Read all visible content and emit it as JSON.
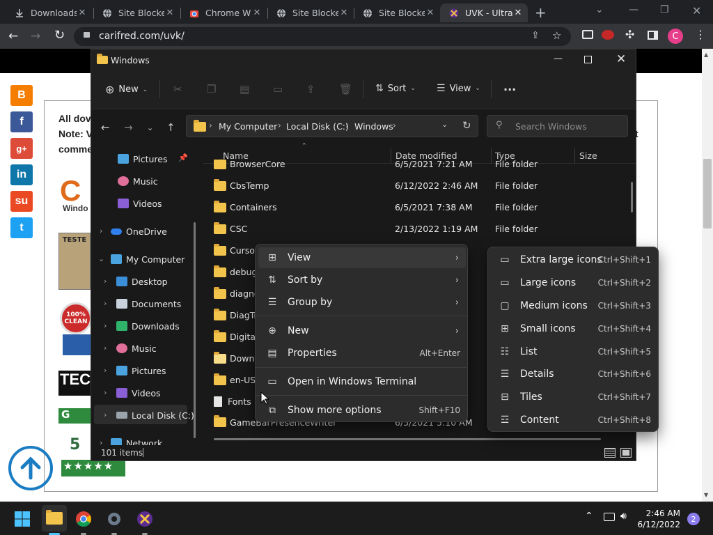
{
  "browser": {
    "tabs": [
      {
        "title": "Downloads",
        "icon": "download-icon"
      },
      {
        "title": "Site Blocke",
        "icon": "globe-icon"
      },
      {
        "title": "Chrome W",
        "icon": "chrome-web-store-icon"
      },
      {
        "title": "Site Blocke",
        "icon": "globe-icon"
      },
      {
        "title": "Site Blocke",
        "icon": "globe-icon"
      },
      {
        "title": "UVK - Ultra",
        "icon": "uvk-icon"
      }
    ],
    "new_tab": "+",
    "url": "carifred.com/uvk/",
    "profile_initial": "C"
  },
  "webpage": {
    "text_line1": "All dov",
    "text_line2": "Note: V",
    "text_line3": "comme",
    "right_char1": "t",
    "badge_tester": "TESTE",
    "badge_clean": "100% CLEAN",
    "badge_teo": "TEC",
    "badge_g": "G",
    "rating_num": "5",
    "logo_text": "Windo",
    "social": [
      "blogger",
      "facebook",
      "google-plus",
      "linkedin",
      "stumbleupon",
      "twitter"
    ]
  },
  "explorer": {
    "title": "Windows",
    "toolbar": {
      "new_label": "New",
      "sort_label": "Sort",
      "view_label": "View",
      "more": "..."
    },
    "breadcrumb": [
      "My Computer",
      "Local Disk (C:)",
      "Windows"
    ],
    "search_placeholder": "Search Windows",
    "nav": [
      {
        "label": "Pictures",
        "pinned": true
      },
      {
        "label": "Music"
      },
      {
        "label": "Videos"
      },
      {
        "label": "OneDrive"
      },
      {
        "label": "My Computer"
      },
      {
        "label": "Desktop"
      },
      {
        "label": "Documents"
      },
      {
        "label": "Downloads"
      },
      {
        "label": "Music"
      },
      {
        "label": "Pictures"
      },
      {
        "label": "Videos"
      },
      {
        "label": "Local Disk (C:)"
      },
      {
        "label": "Network"
      }
    ],
    "columns": [
      "Name",
      "Date modified",
      "Type",
      "Size"
    ],
    "files": [
      {
        "name": "BrowserCore",
        "date": "6/5/2021 7:21 AM",
        "type": "File folder"
      },
      {
        "name": "CbsTemp",
        "date": "6/12/2022 2:46 AM",
        "type": "File folder"
      },
      {
        "name": "Containers",
        "date": "6/5/2021 7:38 AM",
        "type": "File folder"
      },
      {
        "name": "CSC",
        "date": "2/13/2022 1:19 AM",
        "type": "File folder"
      },
      {
        "name": "Cursor",
        "date": "",
        "type": ""
      },
      {
        "name": "debug",
        "date": "",
        "type": ""
      },
      {
        "name": "diagno",
        "date": "",
        "type": ""
      },
      {
        "name": "DiagTra",
        "date": "",
        "type": ""
      },
      {
        "name": "Digitall",
        "date": "",
        "type": ""
      },
      {
        "name": "Downl",
        "date": "",
        "type": ""
      },
      {
        "name": "en-US",
        "date": "",
        "type": ""
      },
      {
        "name": "Fonts",
        "date": "",
        "type": ""
      },
      {
        "name": "GameBarPresenceWriter",
        "date": "6/5/2021 5:10 AM",
        "type": ""
      }
    ],
    "status": "101 items"
  },
  "context_menu": {
    "items": [
      {
        "label": "View",
        "icon": "grid-icon",
        "submenu": true
      },
      {
        "label": "Sort by",
        "icon": "sort-icon",
        "submenu": true
      },
      {
        "label": "Group by",
        "icon": "group-icon",
        "submenu": true
      },
      {
        "label": "New",
        "icon": "plus-circle-icon",
        "submenu": true
      },
      {
        "label": "Properties",
        "icon": "properties-icon",
        "shortcut": "Alt+Enter"
      },
      {
        "label": "Open in Windows Terminal",
        "icon": "terminal-icon"
      },
      {
        "label": "Show more options",
        "icon": "more-options-icon",
        "shortcut": "Shift+F10"
      }
    ]
  },
  "view_submenu": {
    "items": [
      {
        "label": "Extra large icons",
        "shortcut": "Ctrl+Shift+1"
      },
      {
        "label": "Large icons",
        "shortcut": "Ctrl+Shift+2"
      },
      {
        "label": "Medium icons",
        "shortcut": "Ctrl+Shift+3"
      },
      {
        "label": "Small icons",
        "shortcut": "Ctrl+Shift+4"
      },
      {
        "label": "List",
        "shortcut": "Ctrl+Shift+5"
      },
      {
        "label": "Details",
        "shortcut": "Ctrl+Shift+6"
      },
      {
        "label": "Tiles",
        "shortcut": "Ctrl+Shift+7"
      },
      {
        "label": "Content",
        "shortcut": "Ctrl+Shift+8"
      }
    ]
  },
  "taskbar": {
    "time": "2:46 AM",
    "date": "6/12/2022",
    "notification_count": "2"
  },
  "colors": {
    "folder": "#f3c44c",
    "accent_blue": "#1a7cc2",
    "profile": "#e63e8a"
  }
}
